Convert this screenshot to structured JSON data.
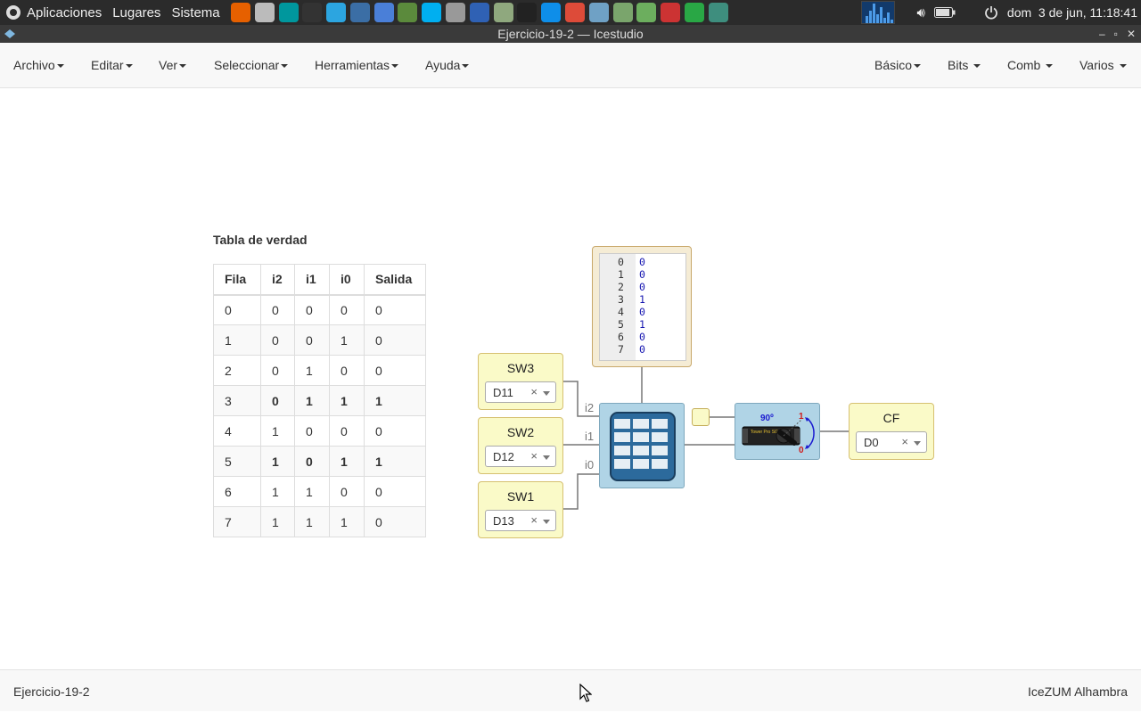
{
  "system_panel": {
    "menus": [
      "Aplicaciones",
      "Lugares",
      "Sistema"
    ],
    "launchers": [
      {
        "icon": "firefox-icon",
        "color": "#e66000"
      },
      {
        "icon": "file-manager-icon",
        "color": "#bbbbbb"
      },
      {
        "icon": "arduino-icon",
        "color": "#00979d"
      },
      {
        "icon": "terminal-icon",
        "color": "#333333"
      },
      {
        "icon": "telegram-icon",
        "color": "#2ca5e0"
      },
      {
        "icon": "monitor-icon",
        "color": "#3b6ea5"
      },
      {
        "icon": "chromium-icon",
        "color": "#4a7fd8"
      },
      {
        "icon": "inkscape-icon",
        "color": "#5b8a3c"
      },
      {
        "icon": "skype-icon",
        "color": "#00aff0"
      },
      {
        "icon": "calculator-icon",
        "color": "#999999"
      },
      {
        "icon": "virtualbox-icon",
        "color": "#2f61b4"
      },
      {
        "icon": "spreadsheet-icon",
        "color": "#8fa87e"
      },
      {
        "icon": "play-icon",
        "color": "#222222"
      },
      {
        "icon": "teamviewer-icon",
        "color": "#0e8ee9"
      },
      {
        "icon": "chrome-icon",
        "color": "#dd4b39"
      },
      {
        "icon": "map-icon",
        "color": "#6fa1c5"
      },
      {
        "icon": "app-icon",
        "color": "#7aa56c"
      },
      {
        "icon": "globe-icon",
        "color": "#6cae5e"
      },
      {
        "icon": "settings-icon",
        "color": "#cc3333"
      },
      {
        "icon": "ccleaner-icon",
        "color": "#29a745"
      },
      {
        "icon": "download-icon",
        "color": "#3e8e7e"
      }
    ],
    "clock": "dom  3 de jun, 11:18:41"
  },
  "window": {
    "title": "Ejercicio-19-2 — Icestudio"
  },
  "menubar": {
    "left": [
      "Archivo",
      "Editar",
      "Ver",
      "Seleccionar",
      "Herramientas",
      "Ayuda"
    ],
    "right": [
      "Básico",
      "Bits",
      "Comb",
      "Varios"
    ]
  },
  "truth_table": {
    "title": "Tabla de verdad",
    "headers": [
      "Fila",
      "i2",
      "i1",
      "i0",
      "Salida"
    ],
    "rows": [
      [
        "0",
        "0",
        "0",
        "0",
        "0"
      ],
      [
        "1",
        "0",
        "0",
        "1",
        "0"
      ],
      [
        "2",
        "0",
        "1",
        "0",
        "0"
      ],
      [
        "3",
        "0",
        "1",
        "1",
        "1"
      ],
      [
        "4",
        "1",
        "0",
        "0",
        "0"
      ],
      [
        "5",
        "1",
        "0",
        "1",
        "1"
      ],
      [
        "6",
        "1",
        "1",
        "0",
        "0"
      ],
      [
        "7",
        "1",
        "1",
        "1",
        "0"
      ]
    ],
    "bold_rows": [
      3,
      5
    ]
  },
  "circuit": {
    "inputs": [
      {
        "label": "SW3",
        "pin": "D11"
      },
      {
        "label": "SW2",
        "pin": "D12"
      },
      {
        "label": "SW1",
        "pin": "D13"
      }
    ],
    "ports": [
      "i2",
      "i1",
      "i0"
    ],
    "memory": [
      {
        "addr": "0",
        "val": "0"
      },
      {
        "addr": "1",
        "val": "0"
      },
      {
        "addr": "2",
        "val": "0"
      },
      {
        "addr": "3",
        "val": "1"
      },
      {
        "addr": "4",
        "val": "0"
      },
      {
        "addr": "5",
        "val": "1"
      },
      {
        "addr": "6",
        "val": "0"
      },
      {
        "addr": "7",
        "val": "0"
      }
    ],
    "servo": {
      "angle_label": "90º",
      "one": "1",
      "zero": "0",
      "brand": "Tower Pro SG-90"
    },
    "output": {
      "label": "CF",
      "pin": "D0"
    },
    "clear_symbol": "×"
  },
  "footer": {
    "left": "Ejercicio-19-2",
    "right": "IceZUM Alhambra"
  }
}
